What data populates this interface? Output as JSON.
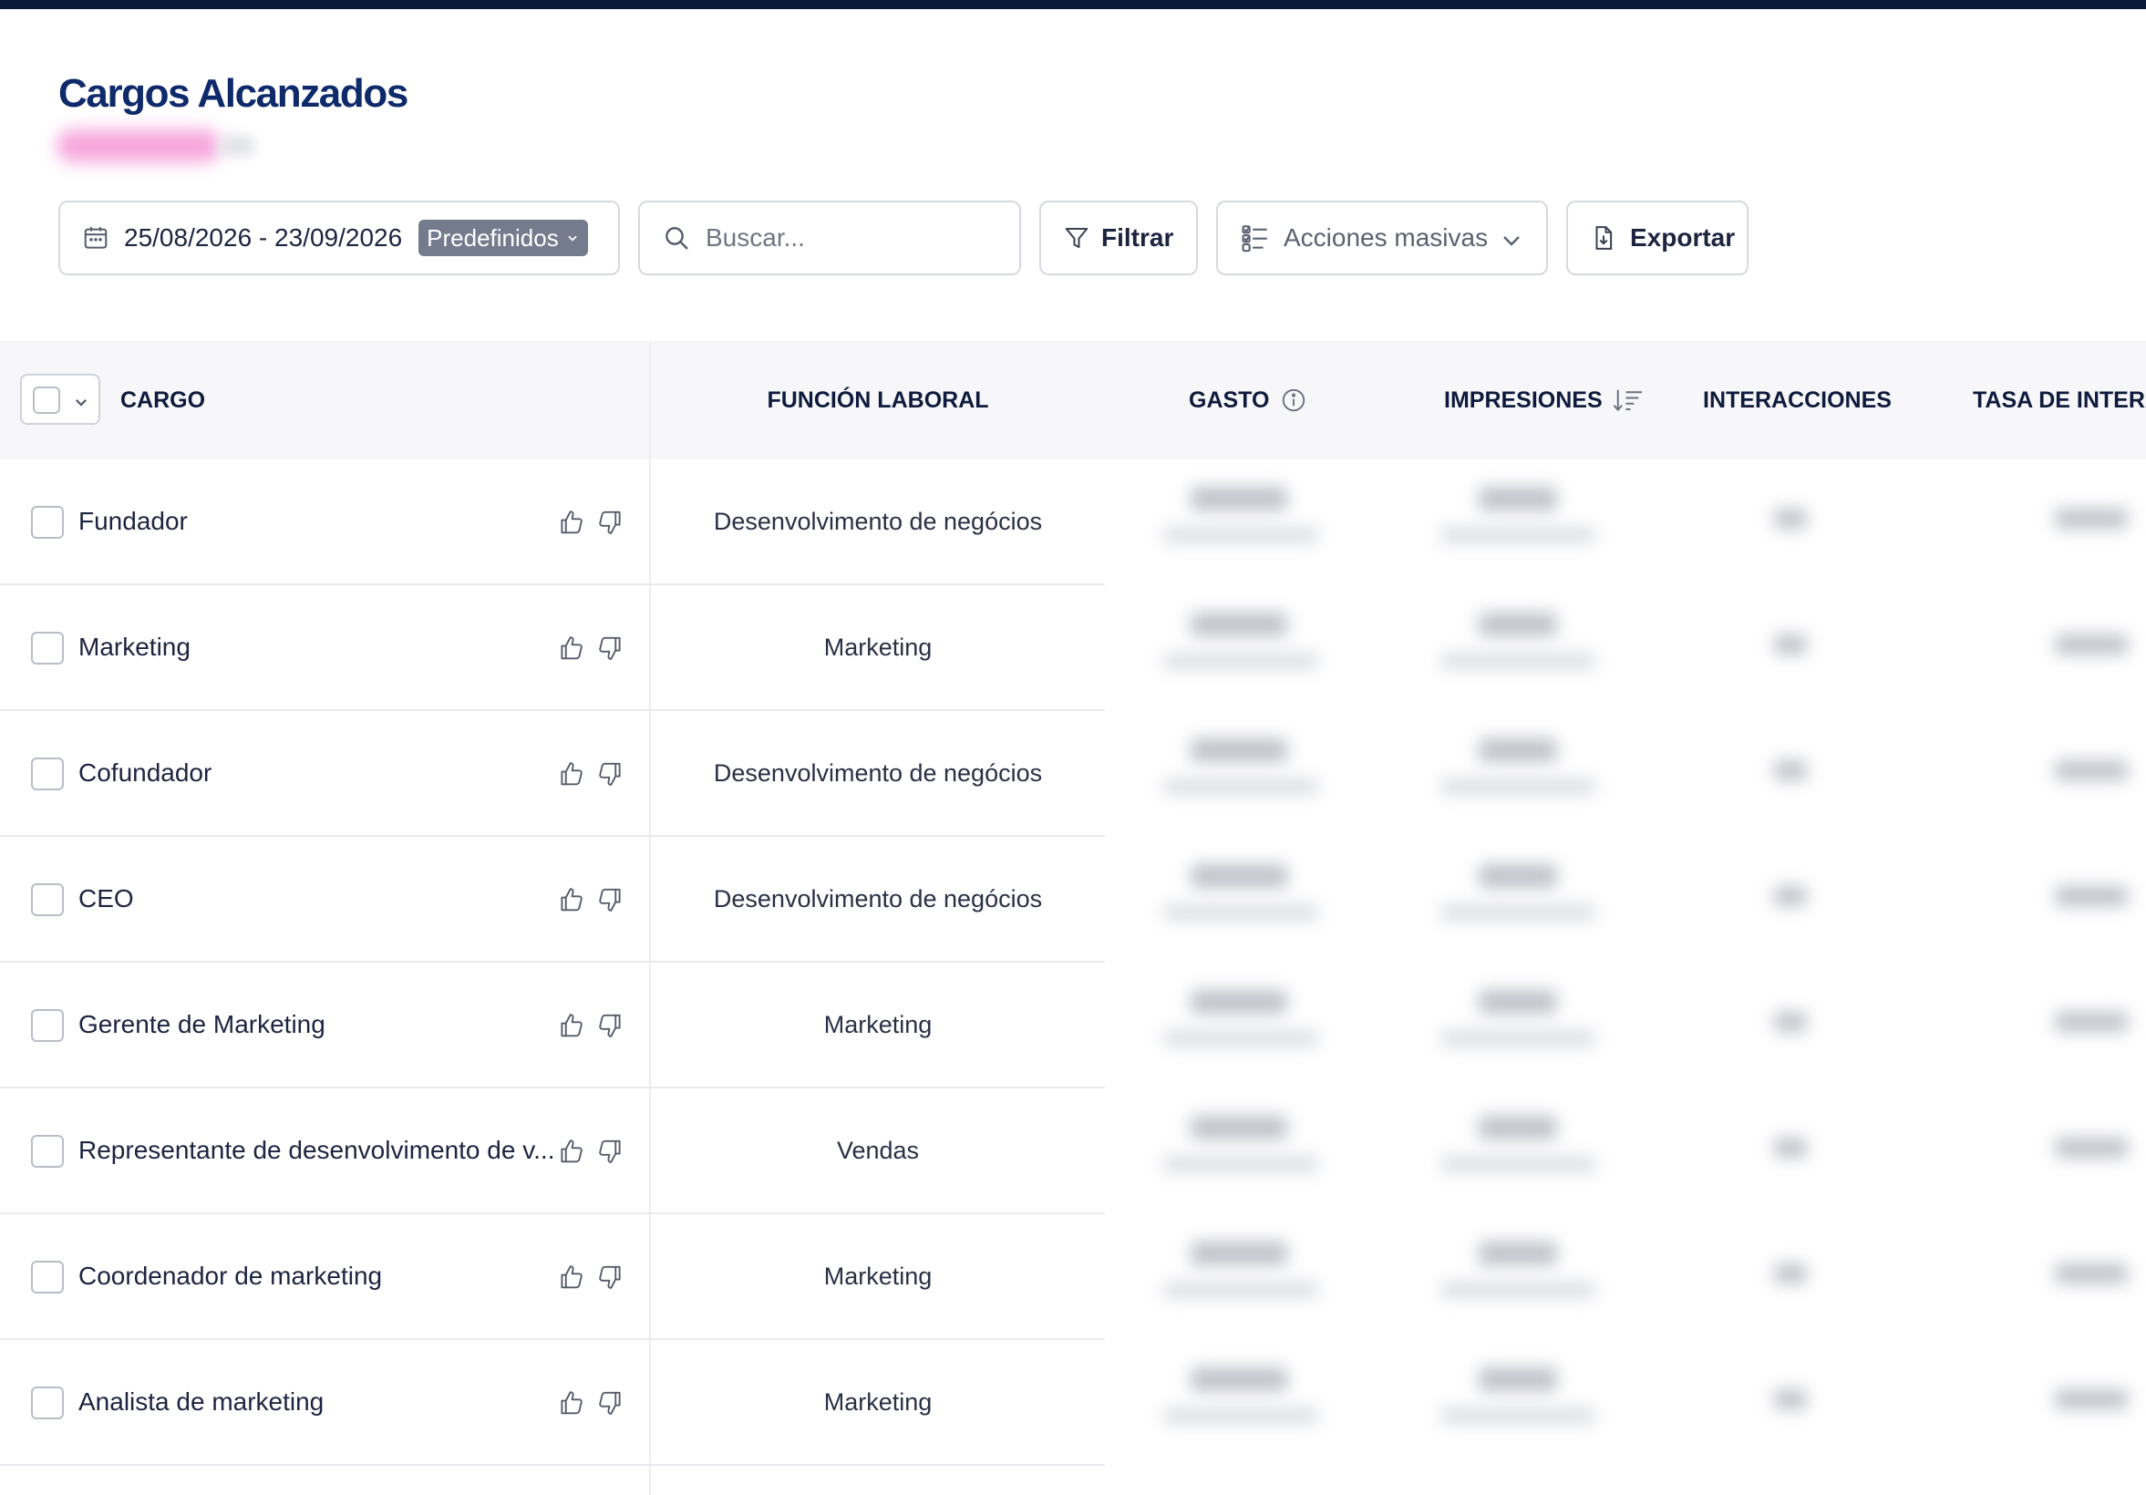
{
  "page": {
    "title": "Cargos Alcanzados"
  },
  "toolbar": {
    "date_range": "25/08/2026 - 23/09/2026",
    "predefined_label": "Predefinidos",
    "search_placeholder": "Buscar...",
    "filter_label": "Filtrar",
    "bulk_actions_label": "Acciones masivas",
    "export_label": "Exportar"
  },
  "table": {
    "columns": {
      "cargo": "CARGO",
      "funcion": "FUNCIÓN LABORAL",
      "gasto": "GASTO",
      "impresiones": "IMPRESIONES",
      "interacciones": "INTERACCIONES",
      "tasa": "TASA DE INTERA"
    },
    "rows": [
      {
        "cargo": "Fundador",
        "funcion": "Desenvolvimento de negócios"
      },
      {
        "cargo": "Marketing",
        "funcion": "Marketing"
      },
      {
        "cargo": "Cofundador",
        "funcion": "Desenvolvimento de negócios"
      },
      {
        "cargo": "CEO",
        "funcion": "Desenvolvimento de negócios"
      },
      {
        "cargo": "Gerente de Marketing",
        "funcion": "Marketing"
      },
      {
        "cargo": "Representante de desenvolvimento de v...",
        "funcion": "Vendas"
      },
      {
        "cargo": "Coordenador de marketing",
        "funcion": "Marketing"
      },
      {
        "cargo": "Analista de marketing",
        "funcion": "Marketing"
      }
    ]
  },
  "icons": [
    "calendar-icon",
    "chevron-down-icon",
    "search-icon",
    "filter-icon",
    "checklist-icon",
    "export-file-icon",
    "info-icon",
    "sort-descending-icon",
    "thumbs-up-icon",
    "thumbs-down-icon"
  ],
  "colors": {
    "title": "#0e2a6b",
    "top_bar": "#0c1838",
    "pill": "#747b8d",
    "header_bg": "#f7f7f9"
  }
}
